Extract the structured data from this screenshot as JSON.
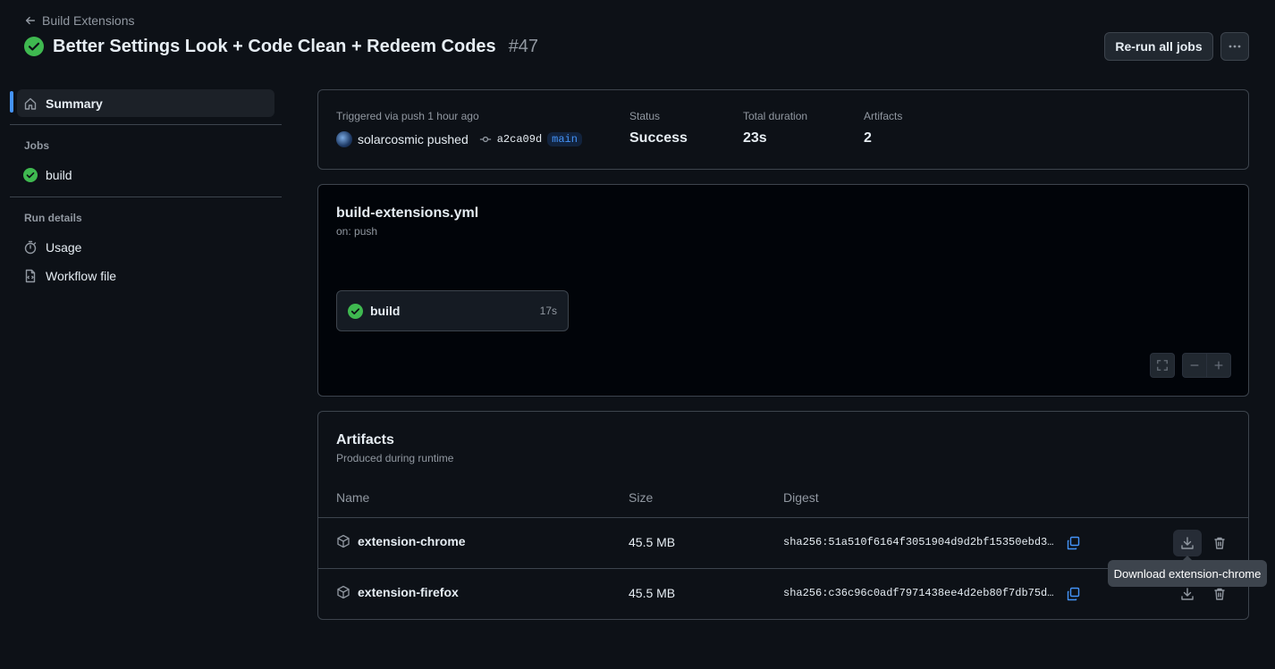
{
  "header": {
    "back_label": "Build Extensions",
    "run_title": "Better Settings Look + Code Clean + Redeem Codes",
    "run_number": "#47",
    "rerun_label": "Re-run all jobs"
  },
  "sidebar": {
    "summary_label": "Summary",
    "jobs_heading": "Jobs",
    "job_label": "build",
    "run_details_heading": "Run details",
    "usage_label": "Usage",
    "workflow_file_label": "Workflow file"
  },
  "summary": {
    "trigger_text": "Triggered via push 1 hour ago",
    "actor": "solarcosmic pushed",
    "commit_sha": "a2ca09d",
    "branch": "main",
    "status_label": "Status",
    "status_value": "Success",
    "duration_label": "Total duration",
    "duration_value": "23s",
    "artifacts_label": "Artifacts",
    "artifacts_value": "2"
  },
  "workflow": {
    "file_name": "build-extensions.yml",
    "trigger": "on: push",
    "job_name": "build",
    "job_duration": "17s"
  },
  "artifacts": {
    "title": "Artifacts",
    "subtitle": "Produced during runtime",
    "columns": [
      "Name",
      "Size",
      "Digest"
    ],
    "rows": [
      {
        "name": "extension-chrome",
        "size": "45.5 MB",
        "digest": "sha256:51a510f6164f3051904d9d2bf15350ebd3..."
      },
      {
        "name": "extension-firefox",
        "size": "45.5 MB",
        "digest": "sha256:c36c96c0adf7971438ee4d2eb80f7db75d..."
      }
    ],
    "tooltip": "Download extension-chrome"
  },
  "colors": {
    "success": "#3fb950",
    "accent": "#4493f8",
    "background": "#0d1117"
  }
}
